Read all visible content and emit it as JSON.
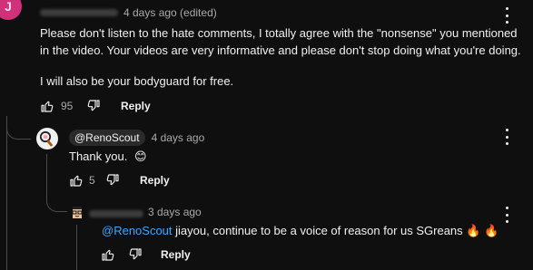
{
  "comment": {
    "avatar_letter": "J",
    "timestamp": "4 days ago (edited)",
    "body_paragraph_1": "Please don't listen to the hate comments, I totally agree with the \"nonsense\" you mentioned in the video. Your videos are very informative and please don't stop doing what you're doing.",
    "body_paragraph_2": "I will also be your bodyguard for free.",
    "like_count": "95",
    "reply_label": "Reply"
  },
  "reply_1": {
    "author": "@RenoScout",
    "timestamp": "4 days ago",
    "body": "Thank you.",
    "emoji": "😊",
    "like_count": "5",
    "reply_label": "Reply"
  },
  "reply_2": {
    "timestamp": "3 days ago",
    "mention": "@RenoScout",
    "body": " jiayou, continue to be a voice of reason for us SGreans ",
    "emoji": "🔥 🔥",
    "reply_label": "Reply"
  },
  "icons": [
    "thumb-up-icon",
    "thumb-down-icon",
    "more-vertical-icon"
  ],
  "colors": {
    "mention": "#3ea6ff",
    "avatar_pink": "#d0317a",
    "background": "#0f0f0f"
  }
}
